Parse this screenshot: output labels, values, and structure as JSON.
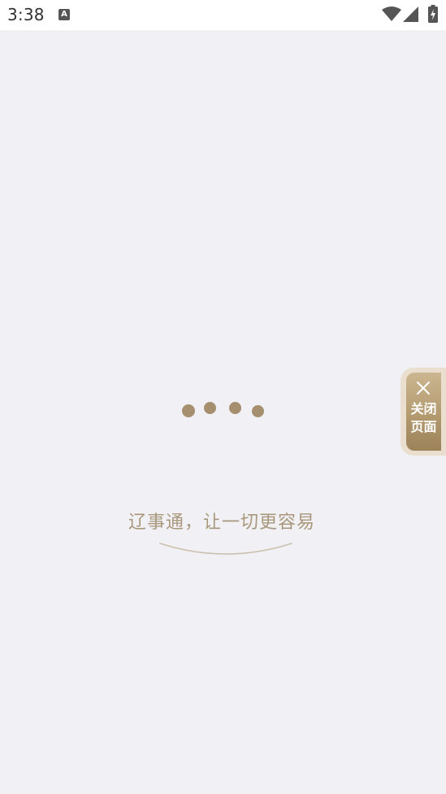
{
  "status_bar": {
    "time": "3:38",
    "notification_icon_letter": "A",
    "icons": [
      "wifi-icon",
      "signal-icon",
      "battery-charging-icon"
    ]
  },
  "loading": {
    "dot_count": 4,
    "color": "#a58f6f"
  },
  "slogan": {
    "text": "辽事通，让一切更容易",
    "color": "#a8977b"
  },
  "close_page": {
    "icon": "close-icon",
    "line1": "关闭",
    "line2": "页面",
    "accent": "#b39a6f"
  },
  "colors": {
    "background": "#f1f1f5",
    "status_bar": "#ffffff"
  }
}
